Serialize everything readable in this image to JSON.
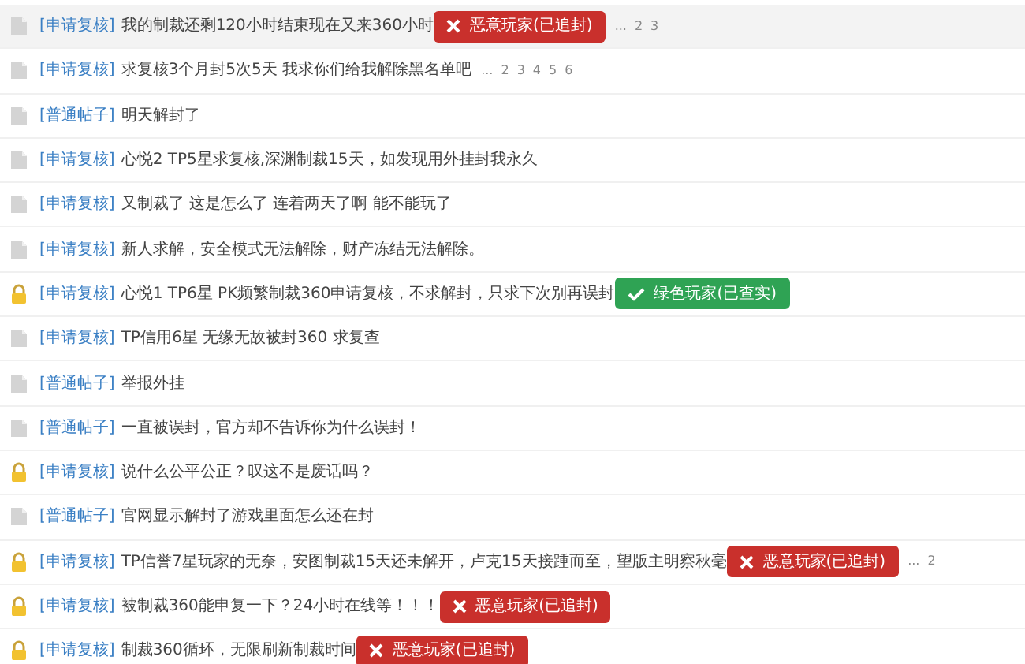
{
  "threads": [
    {
      "locked": false,
      "tag": "[申请复核]",
      "title": "我的制裁还剩120小时结束现在又来360小时",
      "highlighted": true,
      "badge": {
        "kind": "banned",
        "label": "恶意玩家(已追封)"
      },
      "pages": [
        "...",
        "2",
        "3"
      ]
    },
    {
      "locked": false,
      "tag": "[申请复核]",
      "title": "求复核3个月封5次5天 我求你们给我解除黑名单吧",
      "highlighted": false,
      "pages": [
        "...",
        "2",
        "3",
        "4",
        "5",
        "6"
      ]
    },
    {
      "locked": false,
      "tag": "[普通帖子]",
      "title": "明天解封了",
      "highlighted": false
    },
    {
      "locked": false,
      "tag": "[申请复核]",
      "title": "心悦2 TP5星求复核,深渊制裁15天，如发现用外挂封我永久",
      "highlighted": false
    },
    {
      "locked": false,
      "tag": "[申请复核]",
      "title": "又制裁了 这是怎么了 连着两天了啊 能不能玩了",
      "highlighted": false
    },
    {
      "locked": false,
      "tag": "[申请复核]",
      "title": "新人求解，安全模式无法解除，财产冻结无法解除。",
      "highlighted": false
    },
    {
      "locked": true,
      "tag": "[申请复核]",
      "title": "心悦1 TP6星 PK频繁制裁360申请复核，不求解封，只求下次别再误封",
      "highlighted": false,
      "badge": {
        "kind": "verified",
        "label": "绿色玩家(已查实)"
      }
    },
    {
      "locked": false,
      "tag": "[申请复核]",
      "title": "TP信用6星 无缘无故被封360 求复查",
      "highlighted": false
    },
    {
      "locked": false,
      "tag": "[普通帖子]",
      "title": "举报外挂",
      "highlighted": false
    },
    {
      "locked": false,
      "tag": "[普通帖子]",
      "title": "一直被误封，官方却不告诉你为什么误封！",
      "highlighted": false
    },
    {
      "locked": true,
      "tag": "[申请复核]",
      "title": "说什么公平公正？叹这不是废话吗？",
      "highlighted": false
    },
    {
      "locked": false,
      "tag": "[普通帖子]",
      "title": "官网显示解封了游戏里面怎么还在封",
      "highlighted": false
    },
    {
      "locked": true,
      "tag": "[申请复核]",
      "title": "TP信誉7星玩家的无奈，安图制裁15天还未解开，卢克15天接踵而至，望版主明察秋毫",
      "highlighted": false,
      "badge": {
        "kind": "banned",
        "label": "恶意玩家(已追封)"
      },
      "pages": [
        "...",
        "2"
      ]
    },
    {
      "locked": true,
      "tag": "[申请复核]",
      "title": "被制裁360能申复一下？24小时在线等！！！",
      "highlighted": false,
      "badge": {
        "kind": "banned",
        "label": "恶意玩家(已追封)"
      }
    },
    {
      "locked": true,
      "tag": "[申请复核]",
      "title": "制裁360循环，无限刷新制裁时间",
      "highlighted": false,
      "badge": {
        "kind": "banned",
        "label": "恶意玩家(已追封)"
      }
    }
  ]
}
